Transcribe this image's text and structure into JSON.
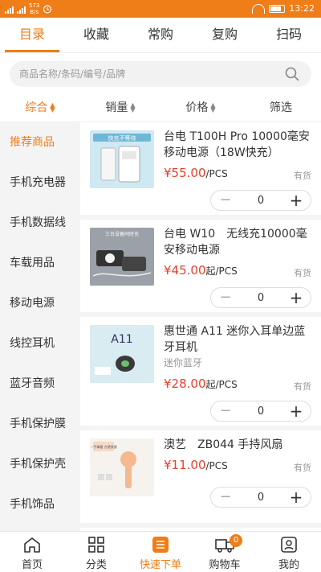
{
  "status_bar": {
    "network_speed": "573",
    "network_unit": "B/s",
    "time": "13:22"
  },
  "tabs": [
    {
      "label": "目录",
      "active": true
    },
    {
      "label": "收藏"
    },
    {
      "label": "常购"
    },
    {
      "label": "复购"
    },
    {
      "label": "扫码"
    }
  ],
  "search": {
    "placeholder": "商品名称/条码/编号/品牌"
  },
  "sort": [
    {
      "label": "综合",
      "active": true
    },
    {
      "label": "销量"
    },
    {
      "label": "价格"
    },
    {
      "label": "筛选"
    }
  ],
  "categories": [
    "推荐商品",
    "手机充电器",
    "手机数据线",
    "车载用品",
    "移动电源",
    "线控耳机",
    "蓝牙音频",
    "手机保护膜",
    "手机保护壳",
    "手机饰品"
  ],
  "products": [
    {
      "name": "台电 T100H Pro 10000毫安移动电源（18W快充）",
      "image_text": "快充不等待",
      "price": "¥55.00",
      "price_unit": "/PCS",
      "stock": "有货",
      "qty": "0"
    },
    {
      "name": "台电 W10　无线充10000毫安移动电源",
      "image_text": "三台设备同时充",
      "price": "¥45.00",
      "price_unit": "起/PCS",
      "stock": "有货",
      "qty": "0"
    },
    {
      "name": "惠世通 A11 迷你入耳单边蓝牙耳机",
      "variant": "迷你蓝牙",
      "image_text": "A11",
      "price": "¥28.00",
      "price_unit": "起/PCS",
      "stock": "有货",
      "qty": "0"
    },
    {
      "name": "澳艺　ZB044 手持风扇",
      "image_text": "一手掌握 方便快捷",
      "price": "¥11.00",
      "price_unit": "/PCS",
      "stock": "有货",
      "qty": "0"
    }
  ],
  "bottom_nav": [
    {
      "label": "首页",
      "icon": "home-icon"
    },
    {
      "label": "分类",
      "icon": "grid-icon"
    },
    {
      "label": "快速下单",
      "icon": "list-icon",
      "active": true
    },
    {
      "label": "购物车",
      "icon": "truck-icon",
      "badge": "0"
    },
    {
      "label": "我的",
      "icon": "profile-icon"
    }
  ],
  "colors": {
    "accent": "#ef7d18",
    "price": "#e5402c"
  }
}
